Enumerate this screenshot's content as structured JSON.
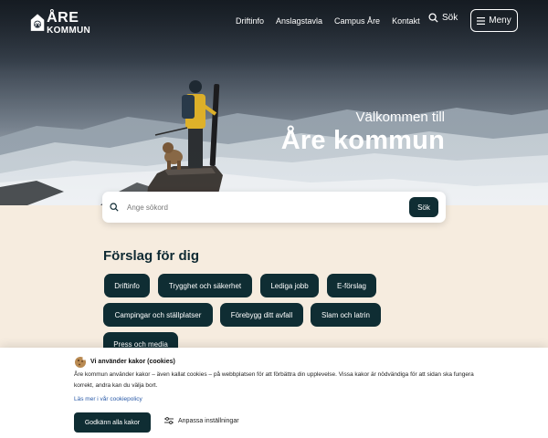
{
  "header": {
    "logo": {
      "top": "ÅRE",
      "bottom": "KOMMUN"
    },
    "nav": [
      "Driftinfo",
      "Anslagstavla",
      "Campus Åre",
      "Kontakt"
    ],
    "search_label": "Sök",
    "menu_label": "Meny"
  },
  "hero": {
    "subtitle": "Välkommen till",
    "title": "Åre kommun"
  },
  "search": {
    "placeholder": "Ange sökord",
    "button": "Sök"
  },
  "suggestions": {
    "title": "Förslag för dig",
    "chips": [
      "Driftinfo",
      "Trygghet och säkerhet",
      "Lediga jobb",
      "E-förslag",
      "Campingar och ställplatser",
      "Förebygg ditt avfall",
      "Slam och latrin",
      "Press och media"
    ]
  },
  "cookie": {
    "title": "Vi använder kakor (cookies)",
    "text": "Åre kommun använder kakor – även kallat cookies – på webbplatsen för att förbättra din upplevelse. Vissa kakor är nödvändiga för att sidan ska fungera korrekt, andra kan du välja bort.",
    "link": "Läs mer i vår cookiepolicy",
    "accept": "Godkänn alla kakor",
    "settings": "Anpassa inställningar"
  }
}
